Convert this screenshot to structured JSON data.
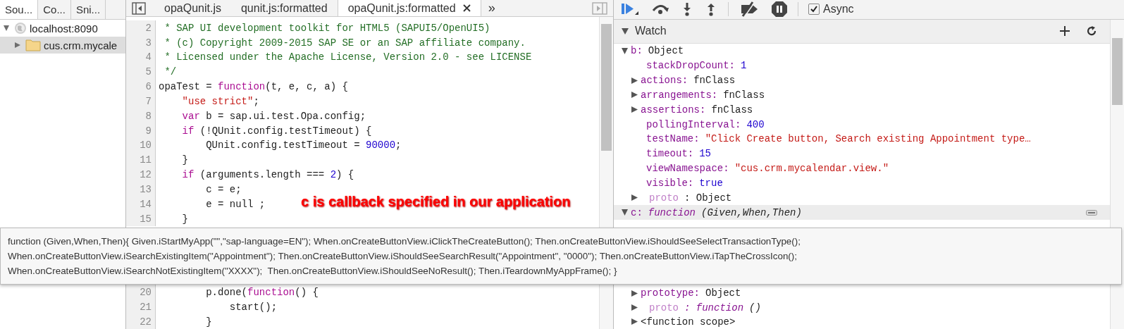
{
  "navigator": {
    "tabs": [
      {
        "label": "Sou...",
        "selected": true
      },
      {
        "label": "Co...",
        "selected": false
      },
      {
        "label": "Sni...",
        "selected": false
      }
    ],
    "tree": [
      {
        "label": "localhost:8090",
        "kind": "host",
        "expanded": true,
        "selected": false,
        "children": [
          {
            "label": "cus.crm.mycale",
            "kind": "folder",
            "expanded": false,
            "selected": true
          }
        ]
      }
    ]
  },
  "editor": {
    "tabs": [
      {
        "label": "opaQunit.js",
        "selected": false,
        "closable": false
      },
      {
        "label": "qunit.js:formatted",
        "selected": false,
        "closable": false
      },
      {
        "label": "opaQunit.js:formatted",
        "selected": true,
        "closable": true
      }
    ],
    "overflow": "»",
    "lines": [
      {
        "number": "2",
        "tokens": [
          {
            "t": " * SAP UI development toolkit for HTML5 (SAPUI5/OpenUI5)",
            "kind": "comment"
          }
        ]
      },
      {
        "number": "3",
        "tokens": [
          {
            "t": " * (c) Copyright 2009-2015 SAP SE or an SAP affiliate company.",
            "kind": "comment"
          }
        ]
      },
      {
        "number": "4",
        "tokens": [
          {
            "t": " * Licensed under the Apache License, Version 2.0 - see LICENSE",
            "kind": "comment"
          }
        ]
      },
      {
        "number": "5",
        "tokens": [
          {
            "t": " */",
            "kind": "comment"
          }
        ]
      },
      {
        "number": "6",
        "tokens": [
          {
            "t": "opaTest = ",
            "kind": "plain"
          },
          {
            "t": "function",
            "kind": "keyword"
          },
          {
            "t": "(t, e, c, a) {",
            "kind": "plain"
          }
        ]
      },
      {
        "number": "7",
        "tokens": [
          {
            "t": "    \"use strict\"",
            "kind": "string"
          },
          {
            "t": ";",
            "kind": "plain"
          }
        ]
      },
      {
        "number": "8",
        "tokens": [
          {
            "t": "    var",
            "kind": "keyword"
          },
          {
            "t": " b = sap.ui.test.Opa.config;",
            "kind": "plain"
          }
        ]
      },
      {
        "number": "9",
        "tokens": [
          {
            "t": "    if",
            "kind": "keyword"
          },
          {
            "t": " (!QUnit.config.testTimeout) {",
            "kind": "plain"
          }
        ]
      },
      {
        "number": "10",
        "tokens": [
          {
            "t": "        QUnit.config.testTimeout = ",
            "kind": "plain"
          },
          {
            "t": "90000",
            "kind": "number"
          },
          {
            "t": ";",
            "kind": "plain"
          }
        ]
      },
      {
        "number": "11",
        "tokens": [
          {
            "t": "    }",
            "kind": "plain"
          }
        ]
      },
      {
        "number": "12",
        "tokens": [
          {
            "t": "    if",
            "kind": "keyword"
          },
          {
            "t": " (arguments.length === ",
            "kind": "plain"
          },
          {
            "t": "2",
            "kind": "number"
          },
          {
            "t": ") {",
            "kind": "plain"
          }
        ]
      },
      {
        "number": "13",
        "tokens": [
          {
            "t": "        c = e;",
            "kind": "plain"
          }
        ]
      },
      {
        "number": "14",
        "tokens": [
          {
            "t": "        e = null ;",
            "kind": "plain"
          }
        ]
      },
      {
        "number": "15",
        "tokens": [
          {
            "t": "    }",
            "kind": "plain"
          }
        ]
      },
      {
        "number": "20",
        "tokens": [
          {
            "t": "        p.done(",
            "kind": "plain"
          },
          {
            "t": "function",
            "kind": "keyword"
          },
          {
            "t": "() {",
            "kind": "plain"
          }
        ]
      },
      {
        "number": "21",
        "tokens": [
          {
            "t": "            start();",
            "kind": "plain"
          }
        ]
      },
      {
        "number": "22",
        "tokens": [
          {
            "t": "        }",
            "kind": "plain"
          }
        ]
      }
    ]
  },
  "debugger": {
    "async": {
      "label": "Async",
      "checked": true
    }
  },
  "watch": {
    "title": "Watch",
    "expanded": true,
    "items": [
      {
        "key": "b:",
        "value": "Object",
        "kind": "object",
        "expandable": true,
        "expanded": true,
        "selected": false,
        "children": [
          {
            "key": "stackDropCount:",
            "value": "1",
            "kind": "number",
            "expandable": false
          },
          {
            "key": "actions:",
            "value": "fnClass",
            "kind": "object",
            "expandable": true,
            "expanded": false
          },
          {
            "key": "arrangements:",
            "value": "fnClass",
            "kind": "object",
            "expandable": true,
            "expanded": false
          },
          {
            "key": "assertions:",
            "value": "fnClass",
            "kind": "object",
            "expandable": true,
            "expanded": false
          },
          {
            "key": "pollingInterval:",
            "value": "400",
            "kind": "number",
            "expandable": false
          },
          {
            "key": "testName:",
            "value": "\"Click Create button, Search existing Appointment type…",
            "kind": "string",
            "expandable": false
          },
          {
            "key": "timeout:",
            "value": "15",
            "kind": "number",
            "expandable": false
          },
          {
            "key": "viewNamespace:",
            "value": "\"cus.crm.mycalendar.view.\"",
            "kind": "string",
            "expandable": false
          },
          {
            "key": "visible:",
            "value": "true",
            "kind": "boolean",
            "expandable": false
          },
          {
            "key": "proto",
            "value": ": Object",
            "kind": "object",
            "expandable": true,
            "expanded": false,
            "internal": true
          }
        ]
      },
      {
        "key": "c:",
        "value": "function",
        "signature": "(Given,When,Then)",
        "kind": "function",
        "expandable": true,
        "expanded": true,
        "selected": true,
        "children": [
          {
            "key": "prototype:",
            "value": "Object",
            "kind": "object",
            "expandable": true,
            "expanded": false
          },
          {
            "key": "proto",
            "value": ": function",
            "signature": "()",
            "kind": "function",
            "expandable": true,
            "expanded": false,
            "internal": true
          },
          {
            "label": "<function scope>",
            "kind": "scope",
            "expandable": true,
            "expanded": false
          }
        ]
      }
    ]
  },
  "tooltip": {
    "lines": [
      "function (Given,When,Then){ Given.iStartMyApp(\"\",\"sap-language=EN\"); When.onCreateButtonView.iClickTheCreateButton(); Then.onCreateButtonView.iShouldSeeSelectTransactionType();",
      "When.onCreateButtonView.iSearchExistingItem(\"Appointment\"); Then.onCreateButtonView.iShouldSeeSearchResult(\"Appointment\", \"0000\"); Then.onCreateButtonView.iTapTheCrossIcon();",
      "When.onCreateButtonView.iSearchNotExistingItem(\"XXXX\");  Then.onCreateButtonView.iShouldSeeNoResult(); Then.iTeardownMyAppFrame(); }"
    ]
  },
  "annotation": {
    "text": "c is callback specified in our application"
  }
}
